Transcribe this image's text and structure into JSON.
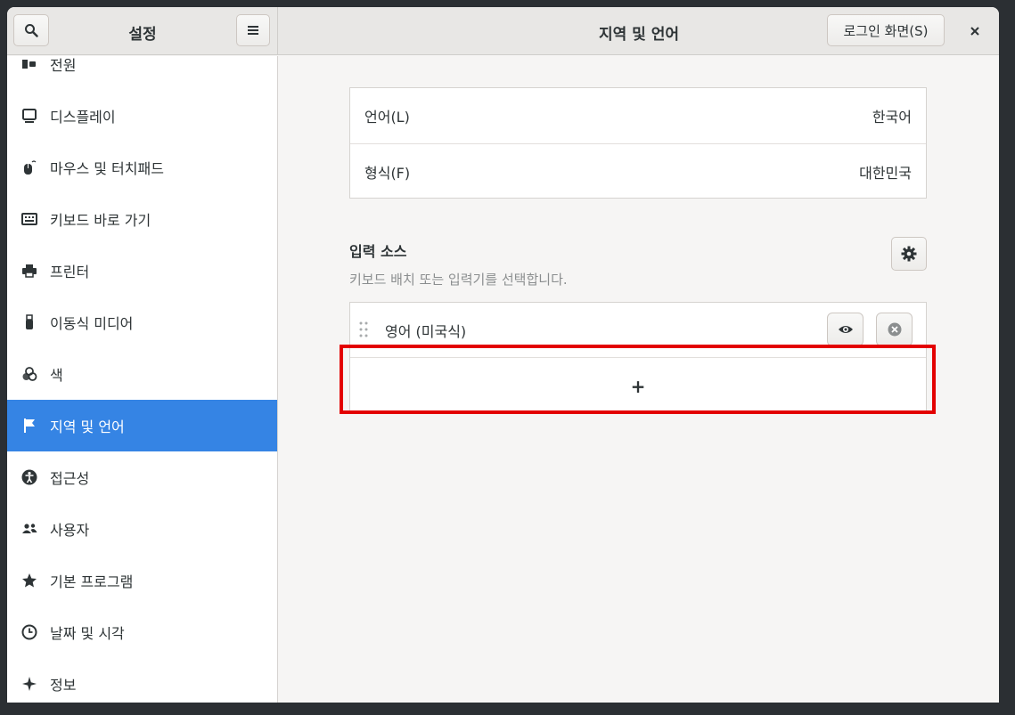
{
  "app": {
    "title": "설정",
    "panel_title": "지역 및 언어",
    "login_screen_button": "로그인 화면(S)"
  },
  "icons": {
    "search": "search-icon",
    "menu": "hamburger-menu-icon",
    "close": "close-icon",
    "settings": "gear-icon",
    "preview": "eye-icon",
    "remove": "remove-circle-icon",
    "drag": "drag-handle-icon"
  },
  "sidebar": {
    "items": [
      {
        "label": "전원",
        "icon": "power-icon"
      },
      {
        "label": "디스플레이",
        "icon": "display-icon"
      },
      {
        "label": "마우스 및 터치패드",
        "icon": "mouse-icon"
      },
      {
        "label": "키보드 바로 가기",
        "icon": "keyboard-icon"
      },
      {
        "label": "프린터",
        "icon": "printer-icon"
      },
      {
        "label": "이동식 미디어",
        "icon": "usb-icon"
      },
      {
        "label": "색",
        "icon": "color-icon"
      },
      {
        "label": "지역 및 언어",
        "icon": "flag-icon",
        "active": true
      },
      {
        "label": "접근성",
        "icon": "accessibility-icon"
      },
      {
        "label": "사용자",
        "icon": "users-icon"
      },
      {
        "label": "기본 프로그램",
        "icon": "star-icon"
      },
      {
        "label": "날짜 및 시각",
        "icon": "clock-icon"
      },
      {
        "label": "정보",
        "icon": "sparkle-icon"
      }
    ]
  },
  "language_settings": {
    "language_label": "언어(L)",
    "language_value": "한국어",
    "formats_label": "형식(F)",
    "formats_value": "대한민국"
  },
  "input_sources": {
    "title": "입력 소스",
    "description": "키보드 배치 또는 입력기를 선택합니다.",
    "sources": [
      {
        "name": "영어 (미국식)"
      }
    ],
    "add_label": "+"
  },
  "colors": {
    "accent": "#3584e4",
    "highlight": "#e30000"
  }
}
